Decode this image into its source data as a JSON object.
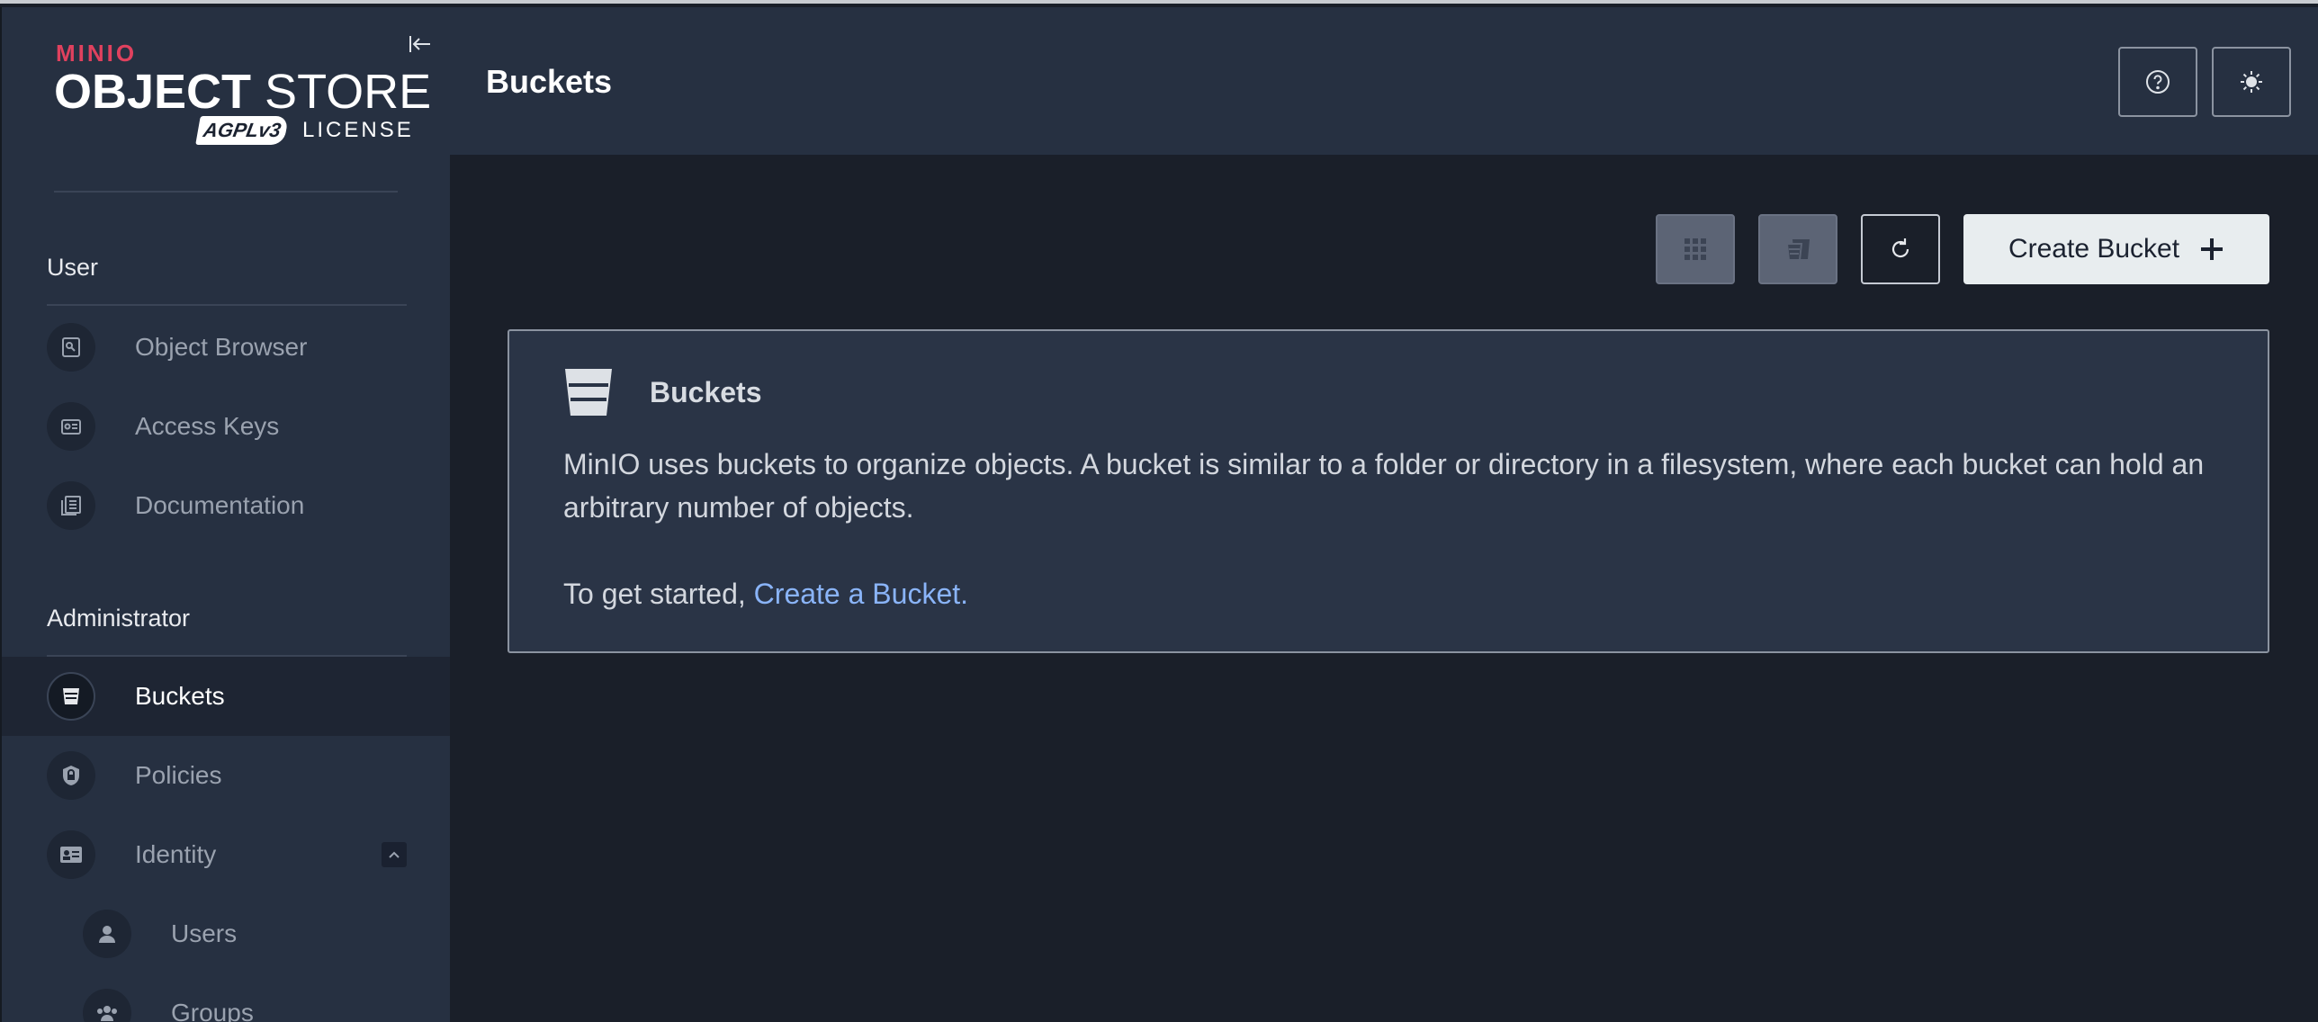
{
  "sidebar": {
    "logo": {
      "brand": "MINIO",
      "product_bold": "OBJECT",
      "product_light": " STORE",
      "badge": "AGPLv3",
      "license": "LICENSE"
    },
    "sections": [
      {
        "title": "User"
      },
      {
        "title": "Administrator"
      }
    ],
    "user_items": [
      {
        "label": "Object Browser",
        "icon": "object-browser-icon"
      },
      {
        "label": "Access Keys",
        "icon": "access-keys-icon"
      },
      {
        "label": "Documentation",
        "icon": "documentation-icon"
      }
    ],
    "admin_items": [
      {
        "label": "Buckets",
        "icon": "bucket-icon",
        "active": true
      },
      {
        "label": "Policies",
        "icon": "policy-shield-icon"
      },
      {
        "label": "Identity",
        "icon": "identity-card-icon",
        "expanded": true
      },
      {
        "label": "Users",
        "icon": "user-icon"
      },
      {
        "label": "Groups",
        "icon": "groups-icon"
      }
    ]
  },
  "header": {
    "title": "Buckets",
    "help_icon": "help-circle-icon",
    "theme_icon": "sun-icon"
  },
  "toolbar": {
    "grid_icon": "grid-view-icon",
    "list_icon": "list-view-icon",
    "refresh_icon": "refresh-icon",
    "create_label": "Create Bucket"
  },
  "card": {
    "title": "Buckets",
    "description": "MinIO uses buckets to organize objects. A bucket is similar to a folder or directory in a filesystem, where each bucket can hold an arbitrary number of objects.",
    "cta_prefix": "To get started, ",
    "cta_link": "Create a Bucket."
  },
  "colors": {
    "sidebar_bg": "#263041",
    "main_bg": "#1a1f29",
    "brand_red": "#e0415e",
    "link": "#8ab4f8"
  }
}
